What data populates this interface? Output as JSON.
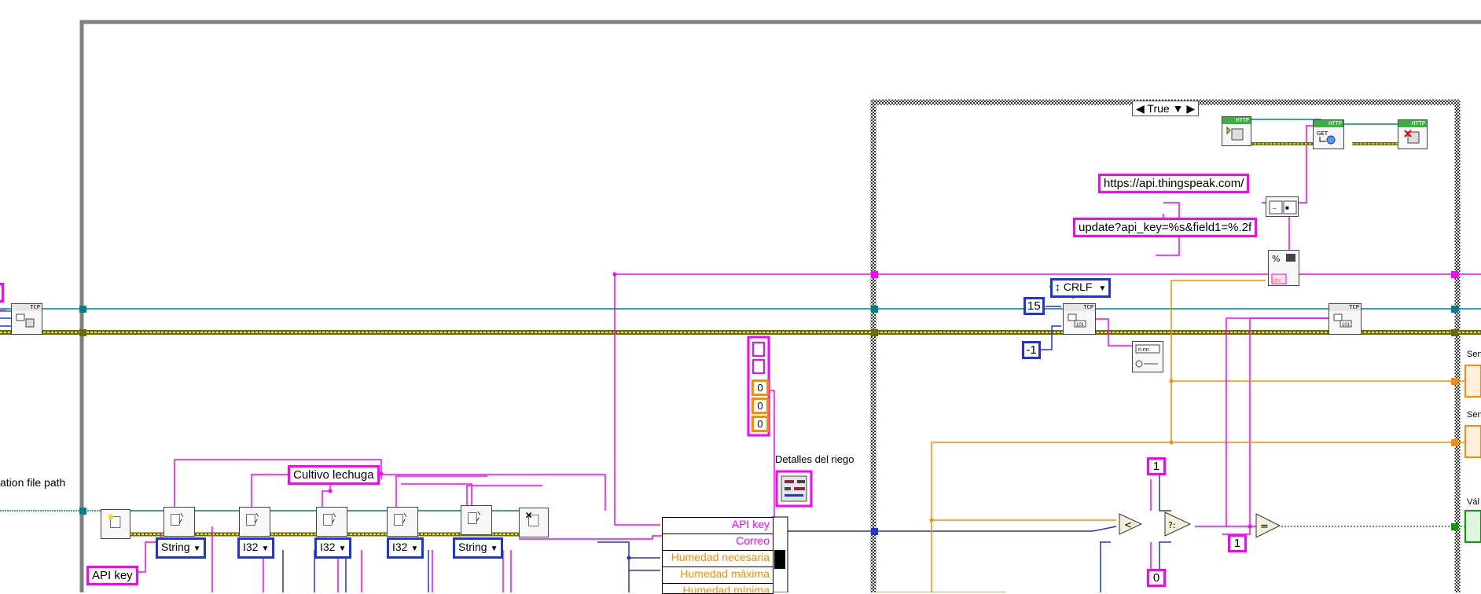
{
  "case_structure": {
    "selector": "True"
  },
  "labels": {
    "config_path": "ation file path",
    "detalles_riego": "Detalles del riego"
  },
  "constants": {
    "url_base": "https://api.thingspeak.com/",
    "update_format": "update?api_key=%s&field1=%.2f",
    "crlf": "CRLF",
    "timeout": "15",
    "minus_one": "-1",
    "one_top": "1",
    "zero": "0",
    "one_left": "1",
    "cultivo": "Cultivo lechuga",
    "api_key_label": "API key",
    "array_vals": [
      "0",
      "0",
      "0"
    ]
  },
  "config_types": [
    "String",
    "I32",
    "I32",
    "I32",
    "String"
  ],
  "bundle_fields": [
    "API key",
    "Correo",
    "Humedad necesaria",
    "Humedad máxima",
    "Humedad mínima"
  ],
  "right_edge_labels": {
    "sen1": "Sen",
    "sen2": "Sen",
    "val": "Vál"
  },
  "http_tags": [
    "HTTP",
    "HTTP",
    "HTTP"
  ],
  "tcp_tags": [
    "TCP",
    "TCP",
    "TCP"
  ],
  "colors": {
    "string_wire": "#ff00ff",
    "numeric_wire": "#ff8c00",
    "i32_wire": "#1f35d6",
    "tcp_wire": "#00808b",
    "error_wire": "#b5b000",
    "bool_wire": "#00a000",
    "frame_gray": "#808080"
  }
}
